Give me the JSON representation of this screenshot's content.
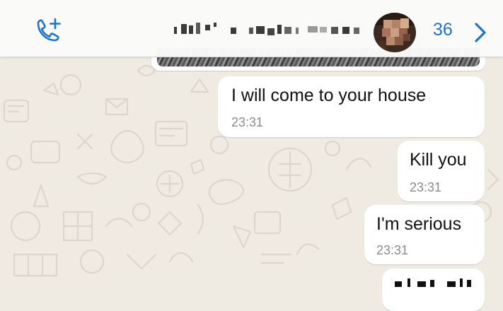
{
  "header": {
    "contact_name": "",
    "unread_count": "36",
    "accent_color": "#1e74c6",
    "icons": [
      "phone-plus-icon",
      "chevron-right-icon"
    ]
  },
  "messages": [
    {
      "text": "I will come to your house",
      "time": "23:31"
    },
    {
      "text": "Kill you",
      "time": "23:31"
    },
    {
      "text": "I'm serious",
      "time": "23:31"
    }
  ],
  "colors": {
    "chat_background": "#efeae2",
    "bubble": "#ffffff",
    "timestamp": "#8b8b8b"
  }
}
